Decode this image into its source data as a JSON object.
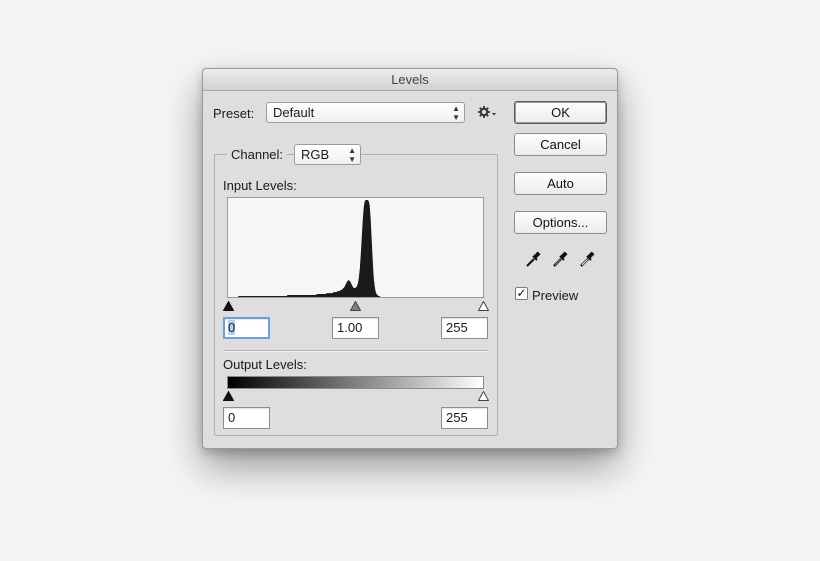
{
  "window": {
    "title": "Levels"
  },
  "preset": {
    "label": "Preset:",
    "value": "Default"
  },
  "channel": {
    "label": "Channel:",
    "value": "RGB"
  },
  "input_levels": {
    "label": "Input Levels:",
    "black_value": "0",
    "gamma_value": "1.00",
    "white_value": "255",
    "histogram": [
      0,
      0,
      0,
      0,
      0,
      0,
      0,
      0,
      0,
      0,
      0,
      1,
      1,
      1,
      1,
      1,
      1,
      1,
      1,
      1,
      1,
      1,
      1,
      1,
      1,
      1,
      1,
      1,
      1,
      1,
      1,
      1,
      1,
      1,
      1,
      1,
      1,
      1,
      1,
      1,
      1,
      1,
      1,
      1,
      1,
      1,
      1,
      1,
      1,
      1,
      1,
      1,
      1,
      1,
      1,
      1,
      1,
      1,
      1,
      1,
      1,
      2,
      2,
      2,
      2,
      2,
      2,
      2,
      2,
      2,
      2,
      2,
      2,
      2,
      2,
      2,
      2,
      2,
      2,
      2,
      2,
      2,
      2,
      2,
      2,
      2,
      2,
      2,
      2,
      2,
      2,
      3,
      3,
      3,
      3,
      3,
      3,
      3,
      3,
      3,
      3,
      4,
      4,
      4,
      4,
      4,
      4,
      4,
      5,
      5,
      5,
      5,
      6,
      6,
      6,
      7,
      7,
      8,
      9,
      10,
      12,
      14,
      16,
      17,
      17,
      16,
      14,
      12,
      10,
      9,
      9,
      10,
      11,
      14,
      20,
      30,
      45,
      62,
      80,
      92,
      98,
      99,
      99,
      99,
      98,
      94,
      80,
      60,
      40,
      22,
      12,
      6,
      3,
      2,
      1,
      1,
      0,
      0,
      0,
      0,
      0,
      0,
      0,
      0,
      0,
      0,
      0,
      0,
      0,
      0,
      0,
      0,
      0,
      0,
      0,
      0,
      0,
      0,
      0,
      0,
      0,
      0,
      0,
      0,
      0,
      0,
      0,
      0,
      0,
      0,
      0,
      0,
      0,
      0,
      0,
      0,
      0,
      0,
      0,
      0,
      0,
      0,
      0,
      0,
      0,
      0,
      0,
      0,
      0,
      0,
      0,
      0,
      0,
      0,
      0,
      0,
      0,
      0,
      0,
      0,
      0,
      0,
      0,
      0,
      0,
      0,
      0,
      0,
      0,
      0,
      0,
      0,
      0,
      0,
      0,
      0,
      0,
      0,
      0,
      0,
      0,
      0,
      0,
      0,
      0,
      0,
      0,
      0,
      0,
      0,
      0,
      0,
      0,
      0,
      0,
      0,
      0,
      0,
      0,
      0,
      0,
      0
    ]
  },
  "output_levels": {
    "label": "Output Levels:",
    "black_value": "0",
    "white_value": "255"
  },
  "buttons": {
    "ok": "OK",
    "cancel": "Cancel",
    "auto": "Auto",
    "options": "Options..."
  },
  "preview": {
    "label": "Preview",
    "checked": true,
    "check_glyph": "✓"
  },
  "icons": {
    "settings": "gear-icon",
    "eyedroppers": [
      "black-eyedropper-icon",
      "gray-eyedropper-icon",
      "white-eyedropper-icon"
    ]
  }
}
